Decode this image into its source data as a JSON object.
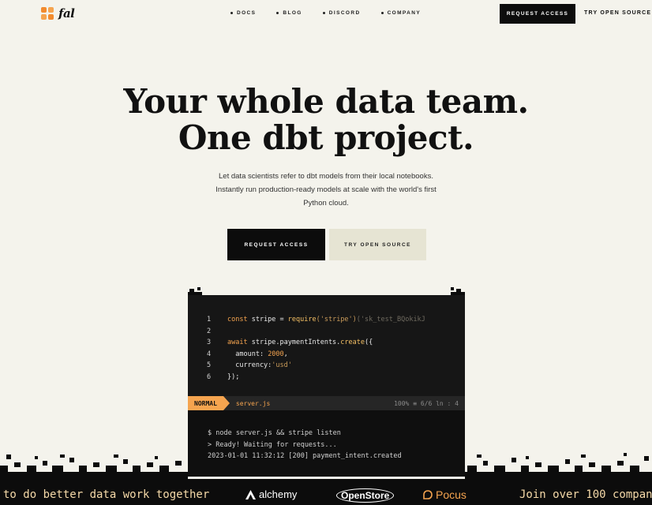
{
  "nav": {
    "logo_text": "fal",
    "links": [
      "DOCS",
      "BLOG",
      "DISCORD",
      "COMPANY"
    ],
    "cta_label": "REQUEST ACCESS",
    "oss_label": "TRY OPEN SOURCE"
  },
  "hero": {
    "title_line1": "Your whole data team.",
    "title_line2": "One dbt project.",
    "subtitle": "Let data scientists refer to dbt models from their local notebooks. Instantly run production-ready models at scale with the world's first Python cloud.",
    "primary_button": "REQUEST ACCESS",
    "secondary_button": "TRY OPEN SOURCE"
  },
  "editor": {
    "line_numbers": [
      "1",
      "2",
      "3",
      "4",
      "5",
      "6"
    ],
    "code": {
      "l1_kw": "const",
      "l1_var": " stripe = ",
      "l1_fn": "require",
      "l1_arg": "('stripe')",
      "l1_str": "('sk_test_BQokikJ",
      "l3_kw": "await",
      "l3_obj": " stripe.paymentIntents.",
      "l3_fn": "create",
      "l3_open": "({",
      "l4_key": "  amount: ",
      "l4_val": "2000",
      "l4_end": ",",
      "l5_key": "  currency:",
      "l5_val": "'usd'",
      "l6": "});"
    },
    "status": {
      "mode": "NORMAL",
      "filename": "server.js",
      "position": "100% ≡ 6/6 ln : 4"
    },
    "terminal": [
      "$ node server.js && stripe listen",
      "> Ready! Waiting for requests...",
      "2023-01-01 11:32:12 [200] payment_intent.created"
    ]
  },
  "footer": {
    "marquee_left": "to do better data work together",
    "brands": [
      "alchemy",
      "OpenStore",
      "Pocus"
    ],
    "marquee_right": "Join over 100 compan"
  },
  "colors": {
    "background": "#f4f3ec",
    "accent": "#f5a44f",
    "dark": "#0c0c0c"
  }
}
